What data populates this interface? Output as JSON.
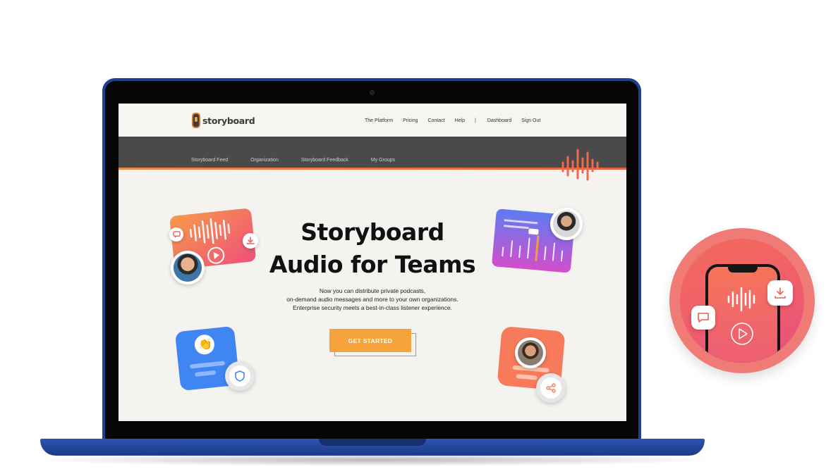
{
  "brand": {
    "name": "storyboard",
    "accent": "#f7a33b",
    "nav_dark": "#4a4a4a",
    "laptop_blue": "#1f3f8f"
  },
  "topnav": {
    "items": [
      "The Platform",
      "Pricing",
      "Contact",
      "Help"
    ],
    "separator": "|",
    "dashboard": "Dashboard",
    "sign_out": "Sign Out"
  },
  "subnav": {
    "items": [
      "Storyboard Feed",
      "Organization",
      "Storyboard Feedback",
      "My Groups"
    ]
  },
  "hero": {
    "title_line1": "Storyboard",
    "title_line2": "Audio for Teams",
    "desc_line1": "Now you can distribute private podcasts,",
    "desc_line2": "on-demand audio messages and more to your own organizations.",
    "desc_line3": "Enterprise security meets a best-in-class listener experience.",
    "cta_label": "GET STARTED"
  },
  "icons": {
    "logo": "microphone-logo-icon",
    "waveform": "audio-waveform-icon",
    "play": "play-icon",
    "download": "download-icon",
    "comment": "comment-icon",
    "shield": "shield-icon",
    "share": "share-icon",
    "clap": "clapping-hands-icon"
  }
}
